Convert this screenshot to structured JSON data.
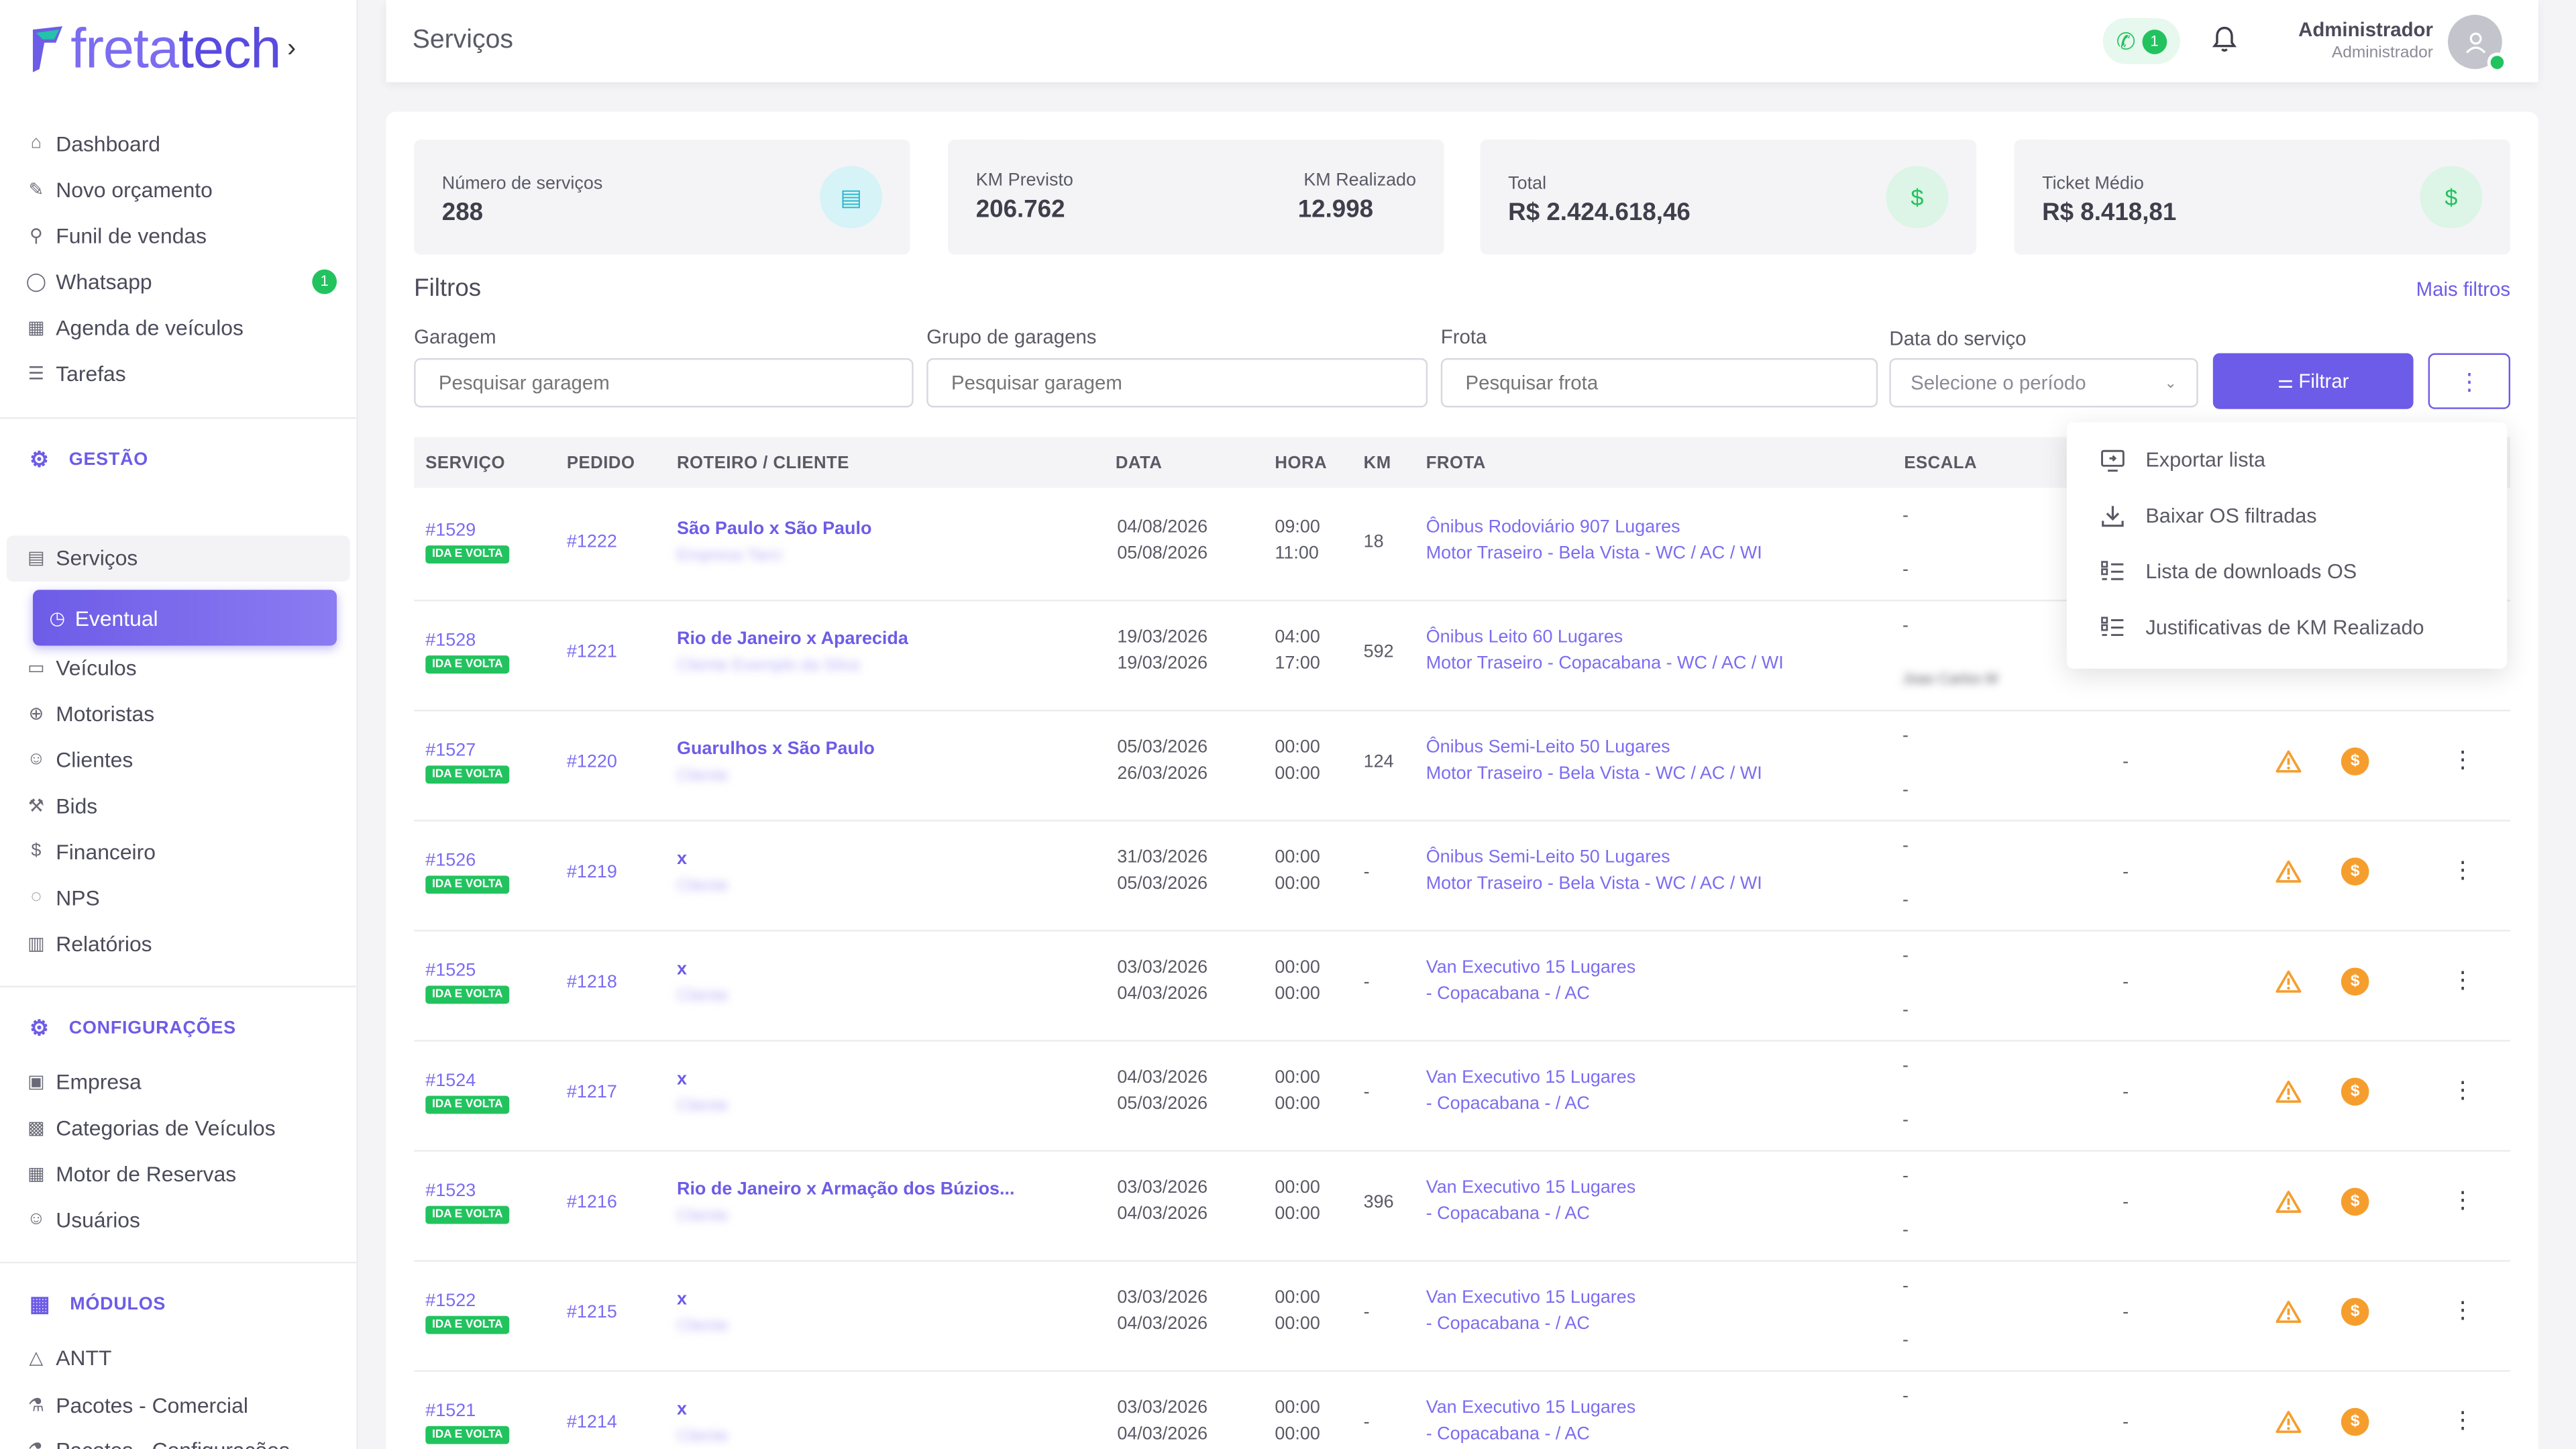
{
  "brand": {
    "name_a": "freta",
    "name_b": "tech"
  },
  "sidebar": {
    "items": [
      {
        "label": "Dashboard",
        "icon": "home-icon",
        "glyph": "⌂"
      },
      {
        "label": "Novo orçamento",
        "icon": "edit-icon",
        "glyph": "✎"
      },
      {
        "label": "Funil de vendas",
        "icon": "funnel-icon",
        "glyph": "⚲"
      },
      {
        "label": "Whatsapp",
        "icon": "whatsapp-icon",
        "glyph": "◯",
        "badge": "1"
      },
      {
        "label": "Agenda de veículos",
        "icon": "calendar-icon",
        "glyph": "▦"
      },
      {
        "label": "Tarefas",
        "icon": "list-icon",
        "glyph": "☰"
      }
    ],
    "sections": {
      "gestao": "GESTÃO",
      "config": "CONFIGURAÇÕES",
      "modulos": "MÓDULOS"
    },
    "gestao_items": [
      {
        "label": "Eventual",
        "icon": "document-icon",
        "glyph": "▤"
      },
      {
        "label": "Serviços",
        "icon": "document-icon",
        "glyph": "▤"
      }
    ],
    "active_item": "Eventual",
    "gestao_items2": [
      {
        "label": "Veículos",
        "icon": "bus-icon",
        "glyph": "▭"
      },
      {
        "label": "Motoristas",
        "icon": "steering-wheel-icon",
        "glyph": "⊕"
      },
      {
        "label": "Clientes",
        "icon": "users-icon",
        "glyph": "☺"
      },
      {
        "label": "Bids",
        "icon": "gavel-icon",
        "glyph": "⚒"
      },
      {
        "label": "Financeiro",
        "icon": "money-icon",
        "glyph": "$"
      },
      {
        "label": "NPS",
        "icon": "chat-icon",
        "glyph": "◌"
      },
      {
        "label": "Relatórios",
        "icon": "report-icon",
        "glyph": "▥"
      }
    ],
    "config_items": [
      {
        "label": "Empresa",
        "icon": "building-icon",
        "glyph": "▣"
      },
      {
        "label": "Categorias de Veículos",
        "icon": "grid-icon",
        "glyph": "▩"
      },
      {
        "label": "Motor de Reservas",
        "icon": "table-icon",
        "glyph": "▦"
      },
      {
        "label": "Usuários",
        "icon": "user-icon",
        "glyph": "☺"
      }
    ],
    "modulos_items": [
      {
        "label": "ANTT",
        "icon": "triangle-icon",
        "glyph": "△"
      },
      {
        "label": "Pacotes - Comercial",
        "icon": "package-icon",
        "glyph": "⚗"
      },
      {
        "label": "Pacotes - Configurações",
        "icon": "package-icon",
        "glyph": "⚗"
      }
    ]
  },
  "header": {
    "title": "Serviços",
    "whatsapp_count": "1",
    "user_name": "Administrador",
    "user_role": "Administrador"
  },
  "stats": {
    "servicos_label": "Número de serviços",
    "servicos_value": "288",
    "km_prev_label": "KM Previsto",
    "km_prev_value": "206.762",
    "km_real_label": "KM Realizado",
    "km_real_value": "12.998",
    "total_label": "Total",
    "total_value": "R$ 2.424.618,46",
    "ticket_label": "Ticket Médio",
    "ticket_value": "R$ 8.418,81"
  },
  "filters": {
    "title": "Filtros",
    "more": "Mais filtros",
    "garagem_label": "Garagem",
    "garagem_placeholder": "Pesquisar garagem",
    "grupo_label": "Grupo de garagens",
    "grupo_placeholder": "Pesquisar garagem",
    "frota_label": "Frota",
    "frota_placeholder": "Pesquisar frota",
    "data_label": "Data do serviço",
    "data_value": "Selecione o período",
    "button": "Filtrar"
  },
  "table": {
    "columns": [
      "SERVIÇO",
      "PEDIDO",
      "ROTEIRO / CLIENTE",
      "DATA",
      "HORA",
      "KM",
      "FROTA",
      "ESCALA"
    ],
    "badge": "IDA E VOLTA",
    "rows": [
      {
        "id": "#1529",
        "pedido": "#1222",
        "roteiro": "São Paulo x São Paulo",
        "cliente": "Empresa Tarci",
        "d1": "04/08/2026",
        "d2": "05/08/2026",
        "h1": "09:00",
        "h2": "11:00",
        "km": "18",
        "f1": "Ônibus Rodoviário 907 Lugares",
        "f2": "Motor Traseiro - Bela Vista - WC / AC / WI",
        "e1": "-",
        "e2": "-"
      },
      {
        "id": "#1528",
        "pedido": "#1221",
        "roteiro": "Rio de Janeiro x Aparecida",
        "cliente": "Cliente Exemplo da Silva",
        "d1": "19/03/2026",
        "d2": "19/03/2026",
        "h1": "04:00",
        "h2": "17:00",
        "km": "592",
        "f1": "Ônibus Leito 60 Lugares",
        "f2": "Motor Traseiro - Copacabana - WC / AC / WI",
        "e1": "-",
        "e2": "Joao Carlos M"
      },
      {
        "id": "#1527",
        "pedido": "#1220",
        "roteiro": "Guarulhos x São Paulo",
        "cliente": "Cliente",
        "d1": "05/03/2026",
        "d2": "26/03/2026",
        "h1": "00:00",
        "h2": "00:00",
        "km": "124",
        "f1": "Ônibus Semi-Leito 50 Lugares",
        "f2": "Motor Traseiro - Bela Vista - WC / AC / WI",
        "e1": "-",
        "e2": "-"
      },
      {
        "id": "#1526",
        "pedido": "#1219",
        "roteiro": "x",
        "cliente": "Cliente",
        "d1": "31/03/2026",
        "d2": "05/03/2026",
        "h1": "00:00",
        "h2": "00:00",
        "km": "-",
        "f1": "Ônibus Semi-Leito 50 Lugares",
        "f2": "Motor Traseiro - Bela Vista - WC / AC / WI",
        "e1": "-",
        "e2": "-"
      },
      {
        "id": "#1525",
        "pedido": "#1218",
        "roteiro": "x",
        "cliente": "Cliente",
        "d1": "03/03/2026",
        "d2": "04/03/2026",
        "h1": "00:00",
        "h2": "00:00",
        "km": "-",
        "f1": "Van Executivo 15 Lugares",
        "f2": "- Copacabana - / AC",
        "e1": "-",
        "e2": "-"
      },
      {
        "id": "#1524",
        "pedido": "#1217",
        "roteiro": "x",
        "cliente": "Cliente",
        "d1": "04/03/2026",
        "d2": "05/03/2026",
        "h1": "00:00",
        "h2": "00:00",
        "km": "-",
        "f1": "Van Executivo 15 Lugares",
        "f2": "- Copacabana - / AC",
        "e1": "-",
        "e2": "-"
      },
      {
        "id": "#1523",
        "pedido": "#1216",
        "roteiro": "Rio de Janeiro x Armação dos Búzios...",
        "cliente": "Cliente",
        "d1": "03/03/2026",
        "d2": "04/03/2026",
        "h1": "00:00",
        "h2": "00:00",
        "km": "396",
        "f1": "Van Executivo 15 Lugares",
        "f2": "- Copacabana - / AC",
        "e1": "-",
        "e2": "-"
      },
      {
        "id": "#1522",
        "pedido": "#1215",
        "roteiro": "x",
        "cliente": "Cliente",
        "d1": "03/03/2026",
        "d2": "04/03/2026",
        "h1": "00:00",
        "h2": "00:00",
        "km": "-",
        "f1": "Van Executivo 15 Lugares",
        "f2": "- Copacabana - / AC",
        "e1": "-",
        "e2": "-"
      },
      {
        "id": "#1521",
        "pedido": "#1214",
        "roteiro": "x",
        "cliente": "Cliente",
        "d1": "03/03/2026",
        "d2": "04/03/2026",
        "h1": "00:00",
        "h2": "00:00",
        "km": "-",
        "f1": "Van Executivo 15 Lugares",
        "f2": "- Copacabana - / AC",
        "e1": "-",
        "e2": "-"
      }
    ],
    "placeholder_dash": "-",
    "coin_symbol": "$"
  },
  "dropdown": {
    "items": [
      {
        "label": "Exportar lista",
        "icon": "export-icon"
      },
      {
        "label": "Baixar OS filtradas",
        "icon": "download-icon"
      },
      {
        "label": "Lista de downloads OS",
        "icon": "list-icon"
      },
      {
        "label": "Justificativas de KM Realizado",
        "icon": "list-icon"
      }
    ]
  },
  "colors": {
    "accent": "#6d5ce7",
    "success": "#22c35e",
    "warning": "#f59e2e"
  }
}
